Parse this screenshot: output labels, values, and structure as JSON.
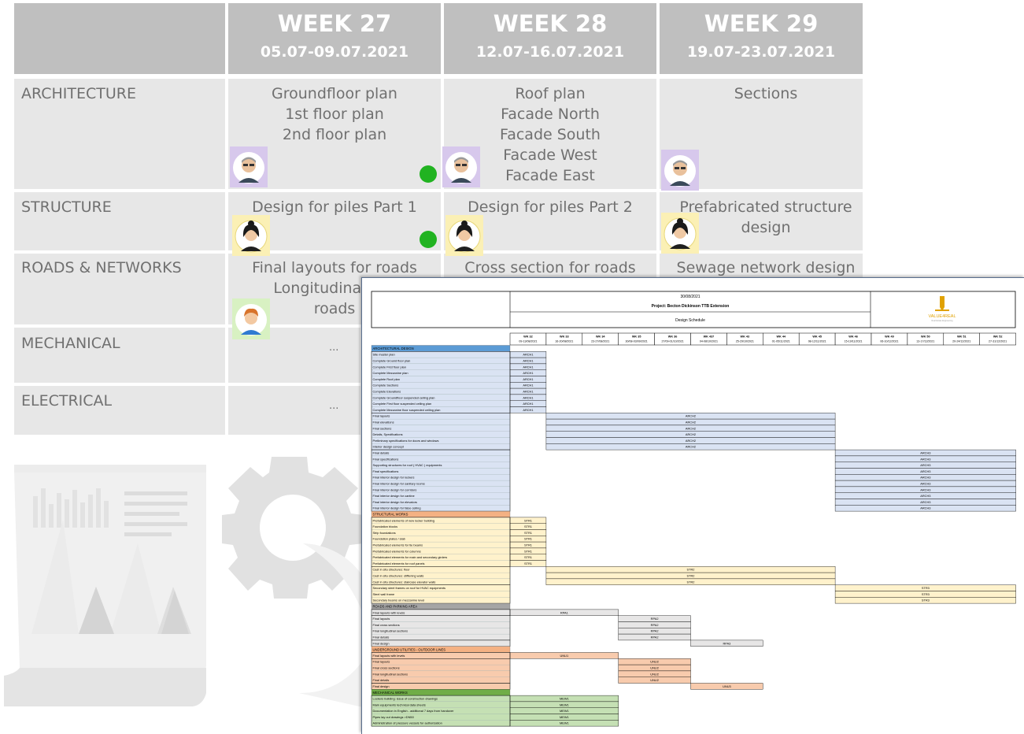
{
  "weeks": [
    {
      "title": "WEEK 27",
      "dates": "05.07-09.07.2021"
    },
    {
      "title": "WEEK 28",
      "dates": "12.07-16.07.2021"
    },
    {
      "title": "WEEK 29",
      "dates": "19.07-23.07.2021"
    }
  ],
  "rows": [
    {
      "label": "ARCHITECTURE",
      "cells": [
        [
          "Groundfloor plan",
          "1st floor plan",
          "2nd floor plan"
        ],
        [
          "Roof plan",
          "Facade North",
          "Facade South",
          "Facade West",
          "Facade East"
        ],
        [
          "Sections"
        ]
      ]
    },
    {
      "label": "STRUCTURE",
      "cells": [
        [
          "Design for piles Part 1"
        ],
        [
          "Design for piles Part 2"
        ],
        [
          "Prefabricated structure",
          "design"
        ]
      ]
    },
    {
      "label": "ROADS & NETWORKS",
      "cells": [
        [
          "Final layouts for roads",
          "Longitudinal sec",
          "roads"
        ],
        [
          "Cross section for roads"
        ],
        [
          "Sewage network design"
        ]
      ]
    },
    {
      "label": "MECHANICAL",
      "cells": [
        [
          "..."
        ]
      ]
    },
    {
      "label": "ELECTRICAL",
      "cells": [
        [
          "..."
        ]
      ]
    }
  ],
  "avatars": {
    "architecture": "male-avatar-icon",
    "structure": "female-avatar-icon",
    "roads": "young-male-avatar-icon"
  },
  "colors": {
    "header_bg": "#bfbfbf",
    "cell_bg": "#e7e7e7",
    "done_dot": "#21b321"
  },
  "schedule": {
    "date": "30/08/2021",
    "project": "Project: Becton Dickinson TTB Extension",
    "subtitle": "Design Schedule",
    "logo_text": "VALUE4REAL",
    "logo_tagline": "Real Estate Engineering",
    "weeks": [
      {
        "wk": "WK 32",
        "dates": "09-13/08/2021"
      },
      {
        "wk": "WK 33",
        "dates": "16-20/08/2021"
      },
      {
        "wk": "WK 34",
        "dates": "23-27/08/2021"
      },
      {
        "wk": "WK 35",
        "dates": "30/08-03/09/2021"
      },
      {
        "wk": "WK 36",
        "dates": "27/09-01/10/2021"
      },
      {
        "wk": "WK 437",
        "dates": "04-08/10/2021"
      },
      {
        "wk": "WK 43",
        "dates": "25-29/10/2021"
      },
      {
        "wk": "WK 44",
        "dates": "01-05/11/2021"
      },
      {
        "wk": "WK 45",
        "dates": "08-12/11/2021"
      },
      {
        "wk": "WK 46",
        "dates": "15-19/11/2021"
      },
      {
        "wk": "WK 49",
        "dates": "06-10/12/2021"
      },
      {
        "wk": "WK 50",
        "dates": "13-17/12/2021"
      },
      {
        "wk": "WK 51",
        "dates": "20-24/12/2021"
      },
      {
        "wk": "WK 52",
        "dates": "27-31/12/2021"
      }
    ],
    "sections": [
      {
        "title": "ARCHITECTURAL DESIGN",
        "color": "#5b9bd5",
        "fill": "#dae3f3",
        "groups": [
          {
            "code": "ARCH1",
            "span": [
              0,
              1
            ],
            "mode": "each",
            "items": [
              "Site master plan",
              "Complete Ground floor plan",
              "Complete First floor plan",
              "Complete Mezzanine plan",
              "Complete Roof plan",
              "Complete Sections",
              "Complete Elevations",
              "Complete Groundfloor suspended ceiling plan",
              "Complete First floor suspended ceiling plan",
              "Complete Mezzanine floor suspended ceiling plan"
            ]
          },
          {
            "code": "ARCH2",
            "span": [
              1,
              9
            ],
            "mode": "each",
            "items": [
              "Final layouts",
              "Final elevations",
              "Final sections",
              "Details, Specifications",
              "Preliminary specifications for doors and windows",
              "Interior design concept"
            ]
          },
          {
            "code": "ARCH3",
            "span": [
              9,
              14
            ],
            "mode": "each",
            "items": [
              "Final details",
              "Final specifications",
              "Supporting structures for roof ( HVAC ) equipments",
              "Final specifications",
              "Final interior design for lockers",
              "Final interior design for sanitary rooms",
              "Final interior design for corridors",
              "Final interior design for cantine",
              "Final interior design for elevators",
              "Final interior design for false ceiling"
            ]
          }
        ]
      },
      {
        "title": "STRUCTURAL WORKS",
        "color": "#f4b183",
        "fill": "#fff2cc",
        "groups": [
          {
            "code": "STR1",
            "span": [
              0,
              1
            ],
            "mode": "each",
            "items": [
              "Prefabricated elements of new locker building",
              "Foundation blocks",
              "Strip foundations",
              "Foundation plates / slab",
              "Prefabricated elements for tie beams",
              "Prefabricated elements for columns",
              "Prefabricated elements for main and secondary girders",
              "Prefabricated elements for roof panels"
            ]
          },
          {
            "code": "STR2",
            "span": [
              1,
              9
            ],
            "mode": "each",
            "items": [
              "Cast in situ structures: floor",
              "Cast in situ structures: stiffening walls",
              "Cast in situ structures: staircase elevator walls"
            ]
          },
          {
            "code": "STR3",
            "span": [
              9,
              14
            ],
            "mode": "each",
            "items": [
              "Secondary steel frames on roof for HVAC equipments",
              "Steel wall frame",
              "Secondary beams on mezzanine level"
            ]
          }
        ]
      },
      {
        "title": "ROADS AND PARKING AREA",
        "color": "#a5a5a5",
        "fill": "#e7e6e6",
        "groups": [
          {
            "code": "RPA1",
            "span": [
              0,
              3
            ],
            "mode": "each",
            "items": [
              "Final layouts with levels"
            ]
          },
          {
            "code": "RPA2",
            "span": [
              3,
              5
            ],
            "mode": "each",
            "items": [
              "Final layouts",
              "Final cross sections",
              "Final longitudinal sections",
              "Final details"
            ]
          },
          {
            "code": "RPA3",
            "span": [
              5,
              7
            ],
            "mode": "each",
            "items": [
              "Final design"
            ]
          }
        ]
      },
      {
        "title": "UNDERGROUND UTILITIES - OUTDOOR LINES",
        "color": "#f4b183",
        "fill": "#f8cbad",
        "groups": [
          {
            "code": "UNU1",
            "span": [
              0,
              3
            ],
            "mode": "each",
            "items": [
              "Final layouts with levels"
            ]
          },
          {
            "code": "UNU2",
            "span": [
              3,
              5
            ],
            "mode": "each",
            "items": [
              "Final layouts",
              "Final cross sections",
              "Final longitudinal sections",
              "Final details"
            ]
          },
          {
            "code": "UNU3",
            "span": [
              5,
              7
            ],
            "mode": "each",
            "items": [
              "Final design"
            ]
          }
        ]
      },
      {
        "title": "MECHANICAL WORKS",
        "color": "#70ad47",
        "fill": "#c5e0b4",
        "groups": [
          {
            "code": "MEW1",
            "span": [
              0,
              3
            ],
            "mode": "each",
            "items": [
              "Lockers building: issue of construction drawings",
              "Main equipments technical data sheets",
              "Documentation in English - additional 7 days from handover",
              "Pipes lay out drawings >DN50",
              "Administration of pressure vessels for authorization"
            ]
          }
        ]
      }
    ]
  }
}
